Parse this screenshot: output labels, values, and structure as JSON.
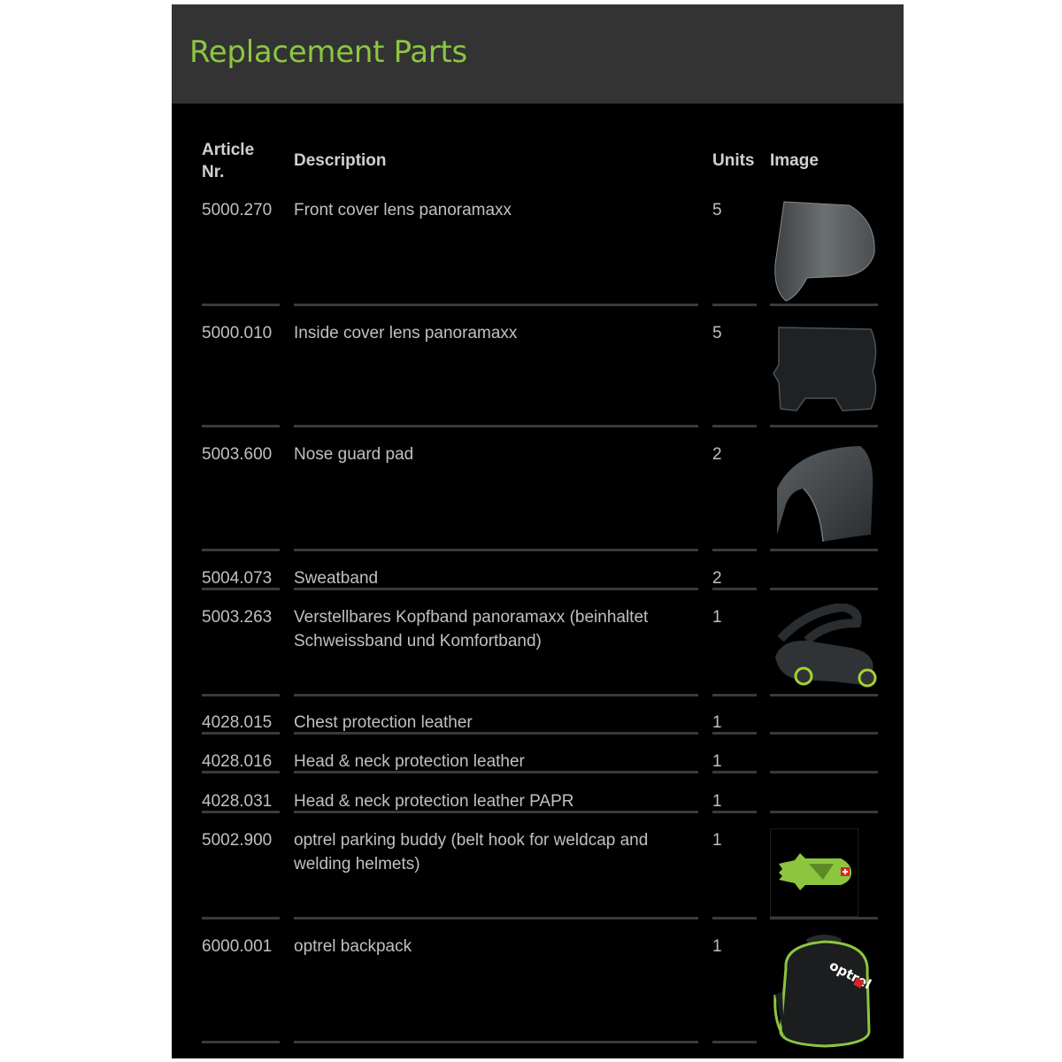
{
  "title": "Replacement Parts",
  "colors": {
    "accent": "#8cc63f",
    "header_bg": "#333333",
    "panel_bg": "#000000"
  },
  "table": {
    "headers": {
      "article": "Article Nr.",
      "description": "Description",
      "units": "Units",
      "image": "Image"
    },
    "rows": [
      {
        "article": "5000.270",
        "description": "Front cover lens panoramaxx",
        "units": "5",
        "image": "front-cover-lens"
      },
      {
        "article": "5000.010",
        "description": "Inside cover lens panoramaxx",
        "units": "5",
        "image": "inside-cover-lens"
      },
      {
        "article": "5003.600",
        "description": "Nose guard pad",
        "units": "2",
        "image": "nose-guard-pad"
      },
      {
        "article": "5004.073",
        "description": "Sweatband",
        "units": "2",
        "image": ""
      },
      {
        "article": "5003.263",
        "description": "Verstellbares Kopfband panoramaxx (beinhaltet",
        "description2": "Schweissband und Komfortband)",
        "units": "1",
        "image": "headband"
      },
      {
        "article": "4028.015",
        "description": "Chest protection leather",
        "units": "1",
        "image": ""
      },
      {
        "article": "4028.016",
        "description": "Head & neck protection leather",
        "units": "1",
        "image": ""
      },
      {
        "article": "4028.031",
        "description": "Head & neck protection leather PAPR",
        "units": "1",
        "image": ""
      },
      {
        "article": "5002.900",
        "description": "optrel parking buddy (belt hook for weldcap and",
        "description2": "welding helmets)",
        "units": "1",
        "image": "parking-buddy"
      },
      {
        "article": "6000.001",
        "description": "optrel backpack",
        "units": "1",
        "image": "backpack"
      }
    ]
  },
  "backpack_brand": "optrel"
}
